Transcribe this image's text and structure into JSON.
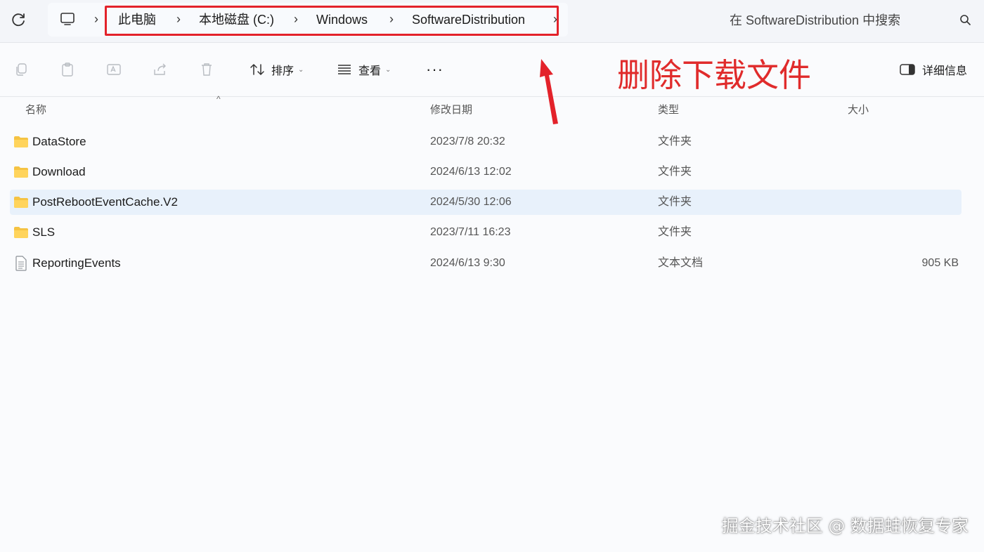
{
  "address_bar": {
    "breadcrumbs": [
      "此电脑",
      "本地磁盘 (C:)",
      "Windows",
      "SoftwareDistribution"
    ],
    "separator": "›",
    "search_placeholder": "在 SoftwareDistribution 中搜索"
  },
  "toolbar": {
    "sort_label": "排序",
    "view_label": "查看",
    "more_label": "···",
    "details_label": "详细信息"
  },
  "annotation": {
    "text": "删除下载文件",
    "color": "#e02b2b"
  },
  "columns": {
    "name": "名称",
    "date": "修改日期",
    "type": "类型",
    "size": "大小"
  },
  "files": [
    {
      "name": "DataStore",
      "date": "2023/7/8 20:32",
      "type": "文件夹",
      "size": "",
      "icon": "folder-icon",
      "selected": false
    },
    {
      "name": "Download",
      "date": "2024/6/13 12:02",
      "type": "文件夹",
      "size": "",
      "icon": "folder-icon",
      "selected": false
    },
    {
      "name": "PostRebootEventCache.V2",
      "date": "2024/5/30 12:06",
      "type": "文件夹",
      "size": "",
      "icon": "folder-icon",
      "selected": true
    },
    {
      "name": "SLS",
      "date": "2023/7/11 16:23",
      "type": "文件夹",
      "size": "",
      "icon": "folder-icon",
      "selected": false
    },
    {
      "name": "ReportingEvents",
      "date": "2024/6/13 9:30",
      "type": "文本文档",
      "size": "905 KB",
      "icon": "text-file-icon",
      "selected": false
    }
  ],
  "watermark": "掘金技术社区 @ 数据蛙恢复专家",
  "colors": {
    "highlight": "#e3222a",
    "selected_row": "#e8f1fb",
    "folder": "#f5c343"
  }
}
